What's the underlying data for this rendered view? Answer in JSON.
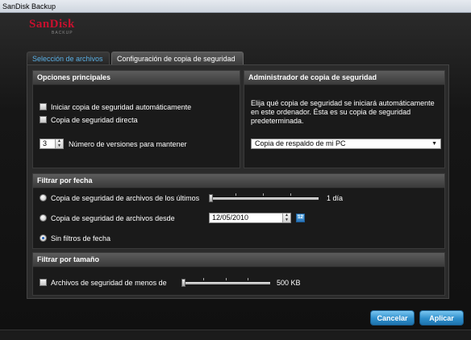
{
  "window": {
    "title": "SanDisk Backup"
  },
  "logo": {
    "brand": "SanDisk",
    "sub": "BACKUP"
  },
  "tabs": [
    {
      "label": "Selección de archivos",
      "active": false
    },
    {
      "label": "Configuración de copia de seguridad",
      "active": true
    }
  ],
  "main_options": {
    "title": "Opciones principales",
    "auto_backup": {
      "label": "Iniciar copia de seguridad automáticamente",
      "checked": false
    },
    "direct_backup": {
      "label": "Copia de seguridad directa",
      "checked": false
    },
    "versions": {
      "value": "3",
      "label": "Número de versiones para mantener"
    }
  },
  "backup_manager": {
    "title": "Administrador de copia de seguridad",
    "description": "Elija qué copia de seguridad se iniciará automáticamente en este ordenador. Ésta es su copia de seguridad predeterminada.",
    "selected": "Copia de respaldo de mi PC"
  },
  "date_filter": {
    "title": "Filtrar por fecha",
    "option_last": {
      "label": "Copia de seguridad de archivos de los últimos",
      "value_label": "1 día",
      "slider_fraction": 0.0
    },
    "option_since": {
      "label": "Copia de seguridad de archivos desde",
      "date": "12/05/2010"
    },
    "option_none": {
      "label": "Sin filtros de fecha",
      "selected": true
    }
  },
  "size_filter": {
    "title": "Filtrar por tamaño",
    "option": {
      "label": "Archivos de seguridad de menos de",
      "value_label": "500 KB",
      "checked": false,
      "slider_fraction": 0.0
    }
  },
  "buttons": {
    "cancel": "Cancelar",
    "apply": "Aplicar"
  },
  "colors": {
    "accent": "#2f8fcc",
    "brand": "#c8102e",
    "tab_inactive_text": "#5ab0e6"
  }
}
